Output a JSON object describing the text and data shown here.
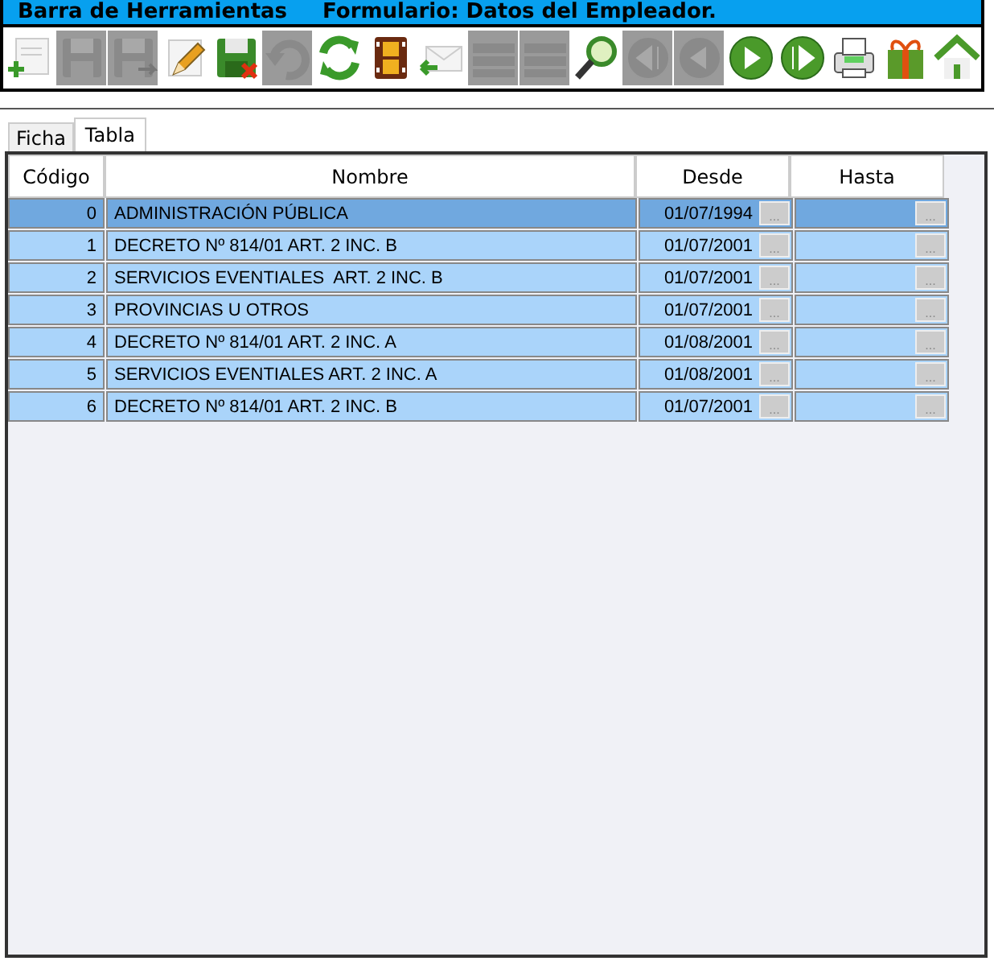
{
  "title_bar": {
    "toolbar_title": "Barra de Herramientas",
    "form_title": "Formulario: Datos del Empleador."
  },
  "toolbar": [
    {
      "kind": "new",
      "disabled": false
    },
    {
      "kind": "save",
      "disabled": true
    },
    {
      "kind": "save-as",
      "disabled": true
    },
    {
      "kind": "edit",
      "disabled": false
    },
    {
      "kind": "save-cancel",
      "disabled": false
    },
    {
      "kind": "undo",
      "disabled": true
    },
    {
      "kind": "refresh",
      "disabled": false
    },
    {
      "kind": "film",
      "disabled": false
    },
    {
      "kind": "mail",
      "disabled": false
    },
    {
      "kind": "list",
      "disabled": true
    },
    {
      "kind": "list",
      "disabled": true
    },
    {
      "kind": "search",
      "disabled": false
    },
    {
      "kind": "first",
      "disabled": true
    },
    {
      "kind": "prev",
      "disabled": true
    },
    {
      "kind": "next",
      "disabled": false
    },
    {
      "kind": "last",
      "disabled": false
    },
    {
      "kind": "print",
      "disabled": false
    },
    {
      "kind": "gift",
      "disabled": false
    },
    {
      "kind": "home",
      "disabled": false
    }
  ],
  "tabs": [
    {
      "label": "Ficha",
      "selected": false
    },
    {
      "label": "Tabla",
      "selected": true
    }
  ],
  "table": {
    "columns": [
      "Código",
      "Nombre",
      "Desde",
      "Hasta"
    ],
    "rows": [
      {
        "codigo": "0",
        "nombre": "ADMINISTRACIÓN PÚBLICA",
        "desde": "01/07/1994",
        "desde_button": "...",
        "hasta_button": "...",
        "selected": true
      },
      {
        "codigo": "1",
        "nombre": "DECRETO Nº 814/01 ART. 2 INC. B",
        "desde": "01/07/2001",
        "desde_button": "...",
        "hasta_button": "...",
        "selected": false
      },
      {
        "codigo": "2",
        "nombre": "SERVICIOS EVENTIALES  ART. 2 INC. B",
        "desde": "01/07/2001",
        "desde_button": "...",
        "hasta_button": "...",
        "selected": false
      },
      {
        "codigo": "3",
        "nombre": "PROVINCIAS U OTROS",
        "desde": "01/07/2001",
        "desde_button": "...",
        "hasta_button": "...",
        "selected": false
      },
      {
        "codigo": "4",
        "nombre": "DECRETO Nº 814/01 ART. 2 INC. A",
        "desde": "01/08/2001",
        "desde_button": "...",
        "hasta_button": "...",
        "selected": false
      },
      {
        "codigo": "5",
        "nombre": "SERVICIOS EVENTIALES ART. 2 INC. A",
        "desde": "01/08/2001",
        "desde_button": "...",
        "hasta_button": "...",
        "selected": false
      },
      {
        "codigo": "6",
        "nombre": "DECRETO Nº 814/01 ART. 2 INC. B",
        "desde": "01/07/2001",
        "desde_button": "...",
        "hasta_button": "...",
        "selected": false
      }
    ]
  }
}
